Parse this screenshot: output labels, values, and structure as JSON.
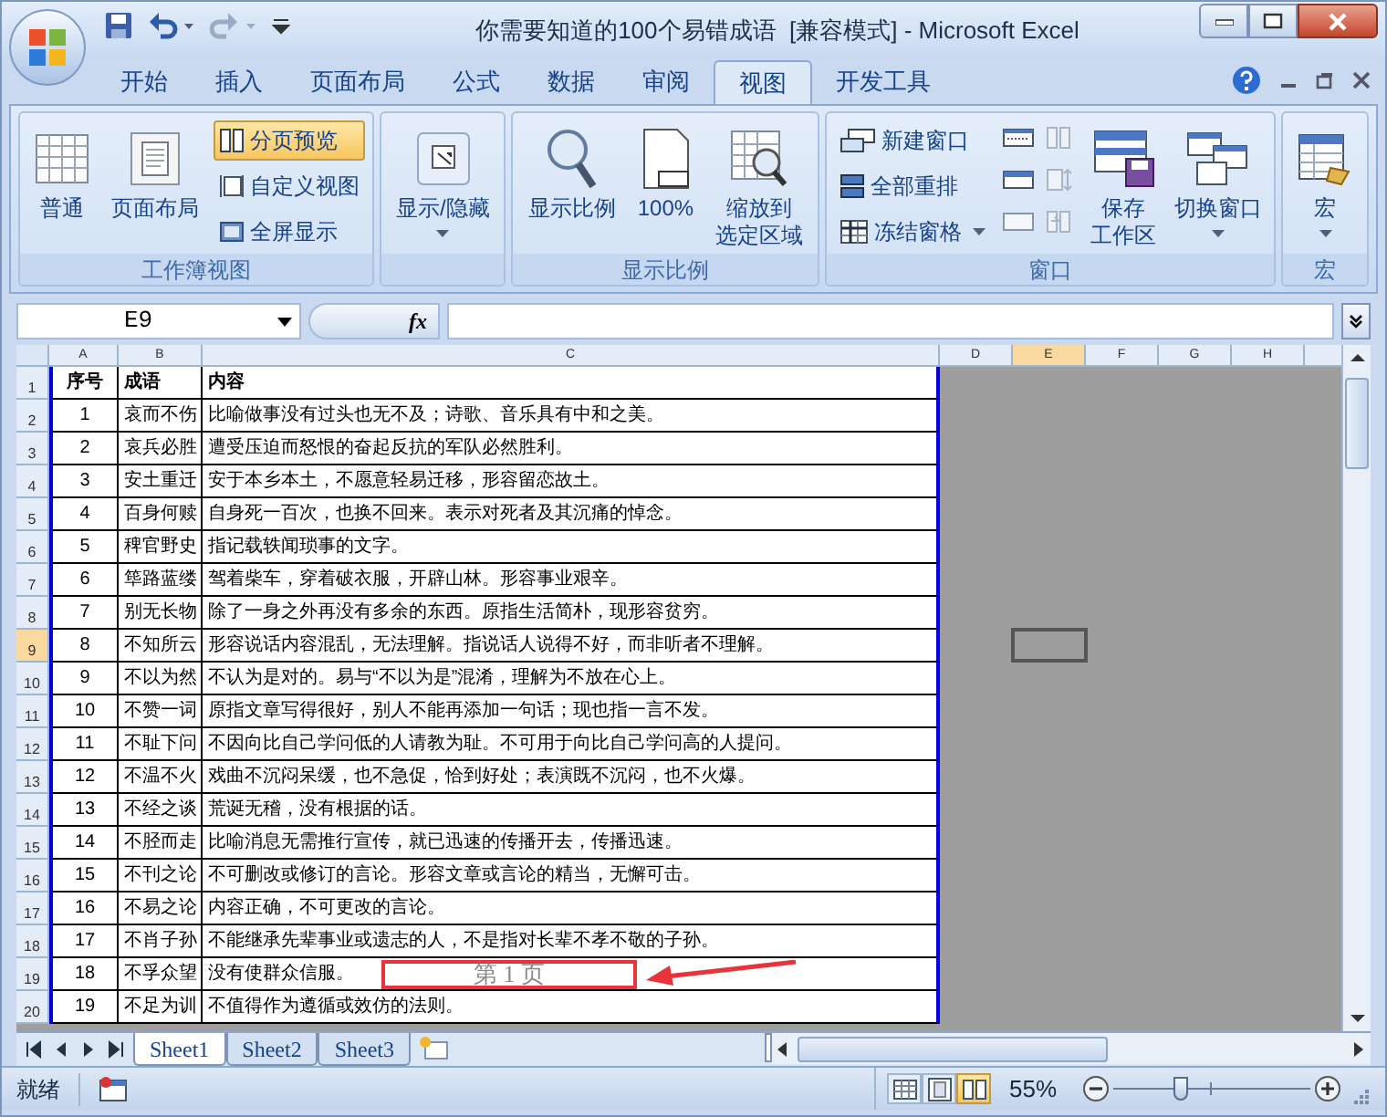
{
  "window": {
    "title": "你需要知道的100个易错成语  [兼容模式] - Microsoft Excel"
  },
  "tabs": [
    {
      "label": "开始",
      "selected": false
    },
    {
      "label": "插入",
      "selected": false
    },
    {
      "label": "页面布局",
      "selected": false
    },
    {
      "label": "公式",
      "selected": false
    },
    {
      "label": "数据",
      "selected": false
    },
    {
      "label": "审阅",
      "selected": false
    },
    {
      "label": "视图",
      "selected": true
    },
    {
      "label": "开发工具",
      "selected": false
    }
  ],
  "ribbon_groups": [
    {
      "label": "工作簿视图",
      "items": [
        {
          "kind": "large",
          "lines": [
            "普通"
          ],
          "selected": false
        },
        {
          "kind": "large",
          "lines": [
            "页面布局"
          ],
          "selected": false
        },
        {
          "kind": "column",
          "items": [
            {
              "label": "分页预览",
              "selected": true
            },
            {
              "label": "自定义视图",
              "selected": false
            },
            {
              "label": "全屏显示",
              "selected": false
            }
          ]
        }
      ]
    },
    {
      "items": [
        {
          "kind": "large",
          "lines": [
            "显示/隐藏"
          ],
          "dropdown": true
        }
      ]
    },
    {
      "label": "显示比例",
      "items": [
        {
          "kind": "large",
          "lines": [
            "显示比例"
          ]
        },
        {
          "kind": "large",
          "lines": [
            "100%"
          ]
        },
        {
          "kind": "large",
          "lines": [
            "缩放到",
            "选定区域"
          ]
        }
      ]
    },
    {
      "label": "窗口",
      "items": [
        {
          "kind": "column",
          "items": [
            {
              "label": "新建窗口"
            },
            {
              "label": "全部重排"
            },
            {
              "label": "冻结窗格",
              "dropdown": true
            }
          ]
        },
        {
          "kind": "icons"
        },
        {
          "kind": "large",
          "lines": [
            "保存",
            "工作区"
          ]
        },
        {
          "kind": "large",
          "lines": [
            "切换窗口"
          ],
          "dropdown": true
        }
      ]
    },
    {
      "label": "宏",
      "items": [
        {
          "kind": "large",
          "lines": [
            "宏"
          ],
          "dropdown": true
        }
      ]
    }
  ],
  "formula_bar": {
    "name_box": "E9",
    "function_label": "fx"
  },
  "columns": [
    {
      "label": "A",
      "selected": false
    },
    {
      "label": "B",
      "selected": false
    },
    {
      "label": "C",
      "selected": false
    },
    {
      "label": "D",
      "selected": false
    },
    {
      "label": "E",
      "selected": true
    },
    {
      "label": "F",
      "selected": false
    },
    {
      "label": "G",
      "selected": false
    },
    {
      "label": "H",
      "selected": false
    }
  ],
  "rows": [
    {
      "number": "1",
      "selected": false,
      "kind": "header",
      "cells": [
        "序号",
        "成语",
        "内容"
      ]
    },
    {
      "number": "2",
      "selected": false,
      "kind": "data",
      "cells": [
        "1",
        "哀而不伤",
        "比喻做事没有过头也无不及；诗歌、音乐具有中和之美。"
      ]
    },
    {
      "number": "3",
      "selected": false,
      "kind": "data",
      "cells": [
        "2",
        "哀兵必胜",
        "遭受压迫而怒恨的奋起反抗的军队必然胜利。"
      ]
    },
    {
      "number": "4",
      "selected": false,
      "kind": "data",
      "cells": [
        "3",
        "安土重迁",
        "安于本乡本土，不愿意轻易迁移，形容留恋故土。"
      ]
    },
    {
      "number": "5",
      "selected": false,
      "kind": "data",
      "cells": [
        "4",
        "百身何赎",
        "自身死一百次，也换不回来。表示对死者及其沉痛的悼念。"
      ]
    },
    {
      "number": "6",
      "selected": false,
      "kind": "data",
      "cells": [
        "5",
        "稗官野史",
        "指记载轶闻琐事的文字。"
      ]
    },
    {
      "number": "7",
      "selected": false,
      "kind": "data",
      "cells": [
        "6",
        "筚路蓝缕",
        "驾着柴车，穿着破衣服，开辟山林。形容事业艰辛。"
      ]
    },
    {
      "number": "8",
      "selected": false,
      "kind": "data",
      "cells": [
        "7",
        "别无长物",
        "除了一身之外再没有多余的东西。原指生活简朴，现形容贫穷。"
      ]
    },
    {
      "number": "9",
      "selected": true,
      "kind": "data",
      "cells": [
        "8",
        "不知所云",
        "形容说话内容混乱，无法理解。指说话人说得不好，而非听者不理解。"
      ]
    },
    {
      "number": "10",
      "selected": false,
      "kind": "data",
      "cells": [
        "9",
        "不以为然",
        "不认为是对的。易与“不以为是”混淆，理解为不放在心上。"
      ]
    },
    {
      "number": "11",
      "selected": false,
      "kind": "data",
      "cells": [
        "10",
        "不赞一词",
        "原指文章写得很好，别人不能再添加一句话；现也指一言不发。"
      ]
    },
    {
      "number": "12",
      "selected": false,
      "kind": "data",
      "cells": [
        "11",
        "不耻下问",
        "不因向比自己学问低的人请教为耻。不可用于向比自己学问高的人提问。"
      ]
    },
    {
      "number": "13",
      "selected": false,
      "kind": "data",
      "cells": [
        "12",
        "不温不火",
        "戏曲不沉闷呆缓，也不急促，恰到好处；表演既不沉闷，也不火爆。"
      ]
    },
    {
      "number": "14",
      "selected": false,
      "kind": "data",
      "cells": [
        "13",
        "不经之谈",
        "荒诞无稽，没有根据的话。"
      ]
    },
    {
      "number": "15",
      "selected": false,
      "kind": "data",
      "cells": [
        "14",
        "不胫而走",
        "比喻消息无需推行宣传，就已迅速的传播开去，传播迅速。"
      ]
    },
    {
      "number": "16",
      "selected": false,
      "kind": "data",
      "cells": [
        "15",
        "不刊之论",
        "不可删改或修订的言论。形容文章或言论的精当，无懈可击。"
      ]
    },
    {
      "number": "17",
      "selected": false,
      "kind": "data",
      "cells": [
        "16",
        "不易之论",
        "内容正确，不可更改的言论。"
      ]
    },
    {
      "number": "18",
      "selected": false,
      "kind": "data",
      "cells": [
        "17",
        "不肖子孙",
        "不能继承先辈事业或遗志的人，不是指对长辈不孝不敬的子孙。"
      ]
    },
    {
      "number": "19",
      "selected": false,
      "kind": "data",
      "cells": [
        "18",
        "不孚众望",
        "没有使群众信服。"
      ]
    },
    {
      "number": "20",
      "selected": false,
      "kind": "data",
      "cells": [
        "19",
        "不足为训",
        "不值得作为遵循或效仿的法则。"
      ]
    }
  ],
  "page_label": "第 1 页",
  "sheet_tabs": [
    {
      "label": "Sheet1",
      "selected": true
    },
    {
      "label": "Sheet2",
      "selected": false
    },
    {
      "label": "Sheet3",
      "selected": false
    }
  ],
  "status_bar": {
    "status": "就绪",
    "views": [
      {
        "selected": false
      },
      {
        "selected": false
      },
      {
        "selected": true
      }
    ],
    "zoom": "55%",
    "zoom_slider": {
      "level": 0.33
    }
  }
}
